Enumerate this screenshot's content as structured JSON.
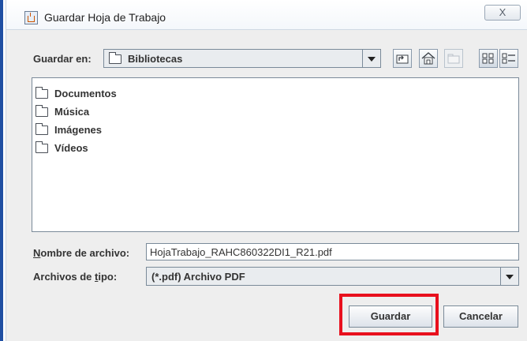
{
  "window": {
    "title": "Guardar Hoja de Trabajo",
    "close_glyph": "X",
    "app_icon": "java-cup-icon"
  },
  "toolbar": {
    "save_in_label": "Guardar en:",
    "location_value": "Bibliotecas",
    "buttons": [
      "up-one-level-icon",
      "home-icon",
      "new-folder-icon",
      "list-view-icon",
      "details-view-icon"
    ]
  },
  "files": [
    {
      "name": "Documentos"
    },
    {
      "name": "Música"
    },
    {
      "name": "Imágenes"
    },
    {
      "name": "Vídeos"
    }
  ],
  "filename": {
    "label_first": "N",
    "label_rest": "ombre de archivo:",
    "value": "HojaTrabajo_RAHC860322DI1_R21.pdf"
  },
  "filetype": {
    "label_prefix": "Archivos de ",
    "label_underlined": "t",
    "label_suffix": "ipo:",
    "value": "(*.pdf) Archivo PDF"
  },
  "actions": {
    "save_label": "Guardar",
    "cancel_label": "Cancelar",
    "highlight_color": "#e8101d"
  }
}
